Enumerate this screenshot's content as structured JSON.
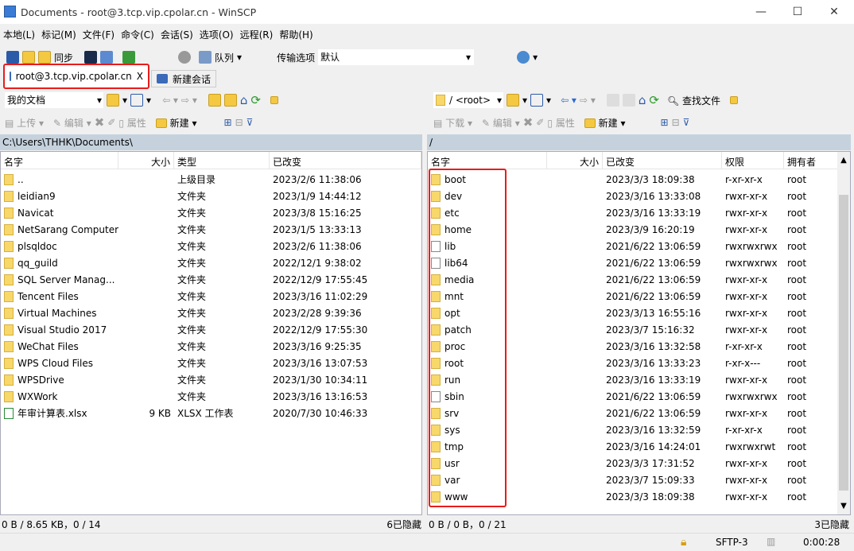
{
  "window": {
    "title": "Documents - root@3.tcp.vip.cpolar.cn - WinSCP",
    "minimize": "—",
    "maximize": "☐",
    "close": "✕"
  },
  "menu": [
    "本地(L)",
    "标记(M)",
    "文件(F)",
    "命令(C)",
    "会话(S)",
    "选项(O)",
    "远程(R)",
    "帮助(H)"
  ],
  "toolbar": {
    "sync": "同步",
    "queue": "队列",
    "transfer_label": "传输选项",
    "transfer_value": "默认"
  },
  "tabs": [
    {
      "label": "root@3.tcp.vip.cpolar.cn",
      "close": "X"
    },
    {
      "label": "新建会话"
    }
  ],
  "left": {
    "location": "我的文档",
    "upload": "上传",
    "edit": "编辑",
    "properties": "属性",
    "new": "新建",
    "path": "C:\\Users\\THHK\\Documents\\",
    "columns": [
      "名字",
      "大小",
      "类型",
      "已改变"
    ],
    "rows": [
      [
        "..",
        "",
        "上级目录",
        "2023/2/6  11:38:06",
        "up"
      ],
      [
        "leidian9",
        "",
        "文件夹",
        "2023/1/9  14:44:12",
        "folder"
      ],
      [
        "Navicat",
        "",
        "文件夹",
        "2023/3/8  15:16:25",
        "folder"
      ],
      [
        "NetSarang Computer",
        "",
        "文件夹",
        "2023/1/5  13:33:13",
        "folder"
      ],
      [
        "plsqldoc",
        "",
        "文件夹",
        "2023/2/6  11:38:06",
        "folder"
      ],
      [
        "qq_guild",
        "",
        "文件夹",
        "2022/12/1  9:38:02",
        "folder"
      ],
      [
        "SQL Server Manag...",
        "",
        "文件夹",
        "2022/12/9  17:55:45",
        "folder"
      ],
      [
        "Tencent Files",
        "",
        "文件夹",
        "2023/3/16  11:02:29",
        "folder"
      ],
      [
        "Virtual Machines",
        "",
        "文件夹",
        "2023/2/28  9:39:36",
        "folder"
      ],
      [
        "Visual Studio 2017",
        "",
        "文件夹",
        "2022/12/9  17:55:30",
        "folder"
      ],
      [
        "WeChat Files",
        "",
        "文件夹",
        "2023/3/16  9:25:35",
        "folder"
      ],
      [
        "WPS Cloud Files",
        "",
        "文件夹",
        "2023/3/16  13:07:53",
        "folder"
      ],
      [
        "WPSDrive",
        "",
        "文件夹",
        "2023/1/30  10:34:11",
        "folder"
      ],
      [
        "WXWork",
        "",
        "文件夹",
        "2023/3/16  13:16:53",
        "folder"
      ],
      [
        "年审计算表.xlsx",
        "9 KB",
        "XLSX 工作表",
        "2020/7/30  10:46:33",
        "xlsx"
      ]
    ],
    "status": "0 B / 8.65 KB，0 / 14",
    "hidden": "6已隐藏"
  },
  "right": {
    "location": "/  <root>",
    "download": "下载",
    "edit": "编辑",
    "properties": "属性",
    "new": "新建",
    "find": "查找文件",
    "path": "/",
    "columns": [
      "名字",
      "大小",
      "已改变",
      "权限",
      "拥有者"
    ],
    "rows": [
      [
        "boot",
        "",
        "2023/3/3 18:09:38",
        "r-xr-xr-x",
        "root",
        "folder"
      ],
      [
        "dev",
        "",
        "2023/3/16 13:33:08",
        "rwxr-xr-x",
        "root",
        "folder"
      ],
      [
        "etc",
        "",
        "2023/3/16 13:33:19",
        "rwxr-xr-x",
        "root",
        "folder"
      ],
      [
        "home",
        "",
        "2023/3/9 16:20:19",
        "rwxr-xr-x",
        "root",
        "folder"
      ],
      [
        "lib",
        "",
        "2021/6/22 13:06:59",
        "rwxrwxrwx",
        "root",
        "link"
      ],
      [
        "lib64",
        "",
        "2021/6/22 13:06:59",
        "rwxrwxrwx",
        "root",
        "link"
      ],
      [
        "media",
        "",
        "2021/6/22 13:06:59",
        "rwxr-xr-x",
        "root",
        "folder"
      ],
      [
        "mnt",
        "",
        "2021/6/22 13:06:59",
        "rwxr-xr-x",
        "root",
        "folder"
      ],
      [
        "opt",
        "",
        "2023/3/13 16:55:16",
        "rwxr-xr-x",
        "root",
        "folder"
      ],
      [
        "patch",
        "",
        "2023/3/7 15:16:32",
        "rwxr-xr-x",
        "root",
        "folder"
      ],
      [
        "proc",
        "",
        "2023/3/16 13:32:58",
        "r-xr-xr-x",
        "root",
        "folder"
      ],
      [
        "root",
        "",
        "2023/3/16 13:33:23",
        "r-xr-x---",
        "root",
        "folder"
      ],
      [
        "run",
        "",
        "2023/3/16 13:33:19",
        "rwxr-xr-x",
        "root",
        "folder"
      ],
      [
        "sbin",
        "",
        "2021/6/22 13:06:59",
        "rwxrwxrwx",
        "root",
        "link"
      ],
      [
        "srv",
        "",
        "2021/6/22 13:06:59",
        "rwxr-xr-x",
        "root",
        "folder"
      ],
      [
        "sys",
        "",
        "2023/3/16 13:32:59",
        "r-xr-xr-x",
        "root",
        "folder"
      ],
      [
        "tmp",
        "",
        "2023/3/16 14:24:01",
        "rwxrwxrwt",
        "root",
        "folder"
      ],
      [
        "usr",
        "",
        "2023/3/3 17:31:52",
        "rwxr-xr-x",
        "root",
        "folder"
      ],
      [
        "var",
        "",
        "2023/3/7 15:09:33",
        "rwxr-xr-x",
        "root",
        "folder"
      ],
      [
        "www",
        "",
        "2023/3/3 18:09:38",
        "rwxr-xr-x",
        "root",
        "folder"
      ]
    ],
    "status": "0 B / 0 B，0 / 21",
    "hidden": "3已隐藏"
  },
  "footer": {
    "protocol": "SFTP-3",
    "time": "0:00:28"
  },
  "colors": {
    "highlight": "#e81c1c",
    "pathbar": "#c5d2de"
  }
}
